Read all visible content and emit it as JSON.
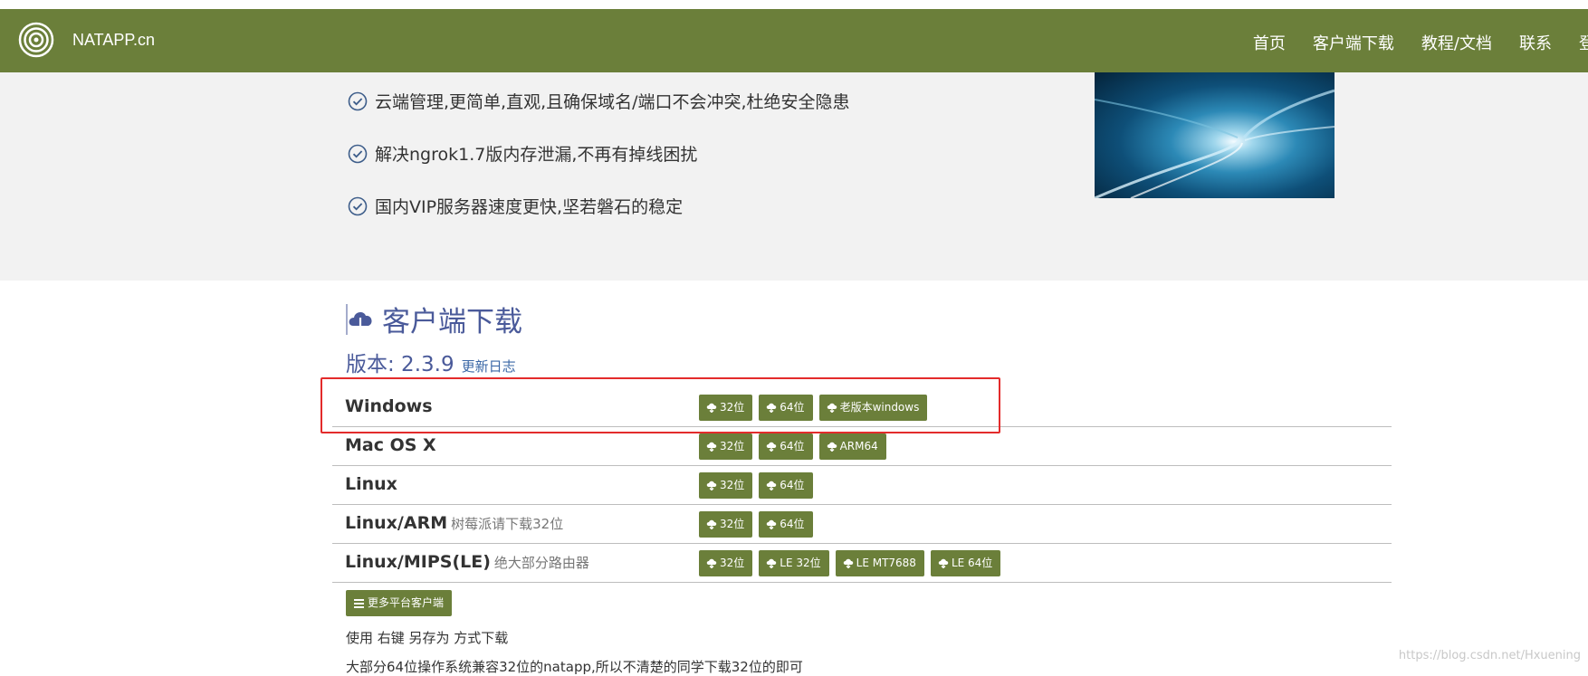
{
  "navbar": {
    "brand": "NATAPP.cn",
    "items": [
      "首页",
      "客户端下载",
      "教程/文档",
      "联系",
      "登"
    ]
  },
  "hero": {
    "features": [
      "云端管理,更简单,直观,且确保域名/端口不会冲突,杜绝安全隐患",
      "解决ngrok1.7版内存泄漏,不再有掉线困扰",
      "国内VIP服务器速度更快,坚若磐石的稳定"
    ]
  },
  "downloads": {
    "title": "客户端下载",
    "version_label": "版本: 2.3.9",
    "changelog": "更新日志",
    "rows": [
      {
        "platform": "Windows",
        "note": "",
        "buttons": [
          "32位",
          "64位",
          "老版本windows"
        ]
      },
      {
        "platform": "Mac OS X",
        "note": "",
        "buttons": [
          "32位",
          "64位",
          "ARM64"
        ]
      },
      {
        "platform": "Linux",
        "note": "",
        "buttons": [
          "32位",
          "64位"
        ]
      },
      {
        "platform": "Linux/ARM",
        "note": "树莓派请下载32位",
        "buttons": [
          "32位",
          "64位"
        ]
      },
      {
        "platform": "Linux/MIPS(LE)",
        "note": "绝大部分路由器",
        "buttons": [
          "32位",
          "LE 32位",
          "LE MT7688",
          "LE 64位"
        ]
      }
    ],
    "more_button": "更多平台客户端",
    "notes": [
      "使用 右键 另存为 方式下载",
      "大部分64位操作系统兼容32位的natapp,所以不清楚的同学下载32位的即可"
    ]
  },
  "watermark": "https://blog.csdn.net/Hxuening",
  "colors": {
    "navbar": "#6b7f3a",
    "button": "#6b7f3a",
    "title": "#4a5a9a",
    "highlight": "#e32b2b"
  }
}
